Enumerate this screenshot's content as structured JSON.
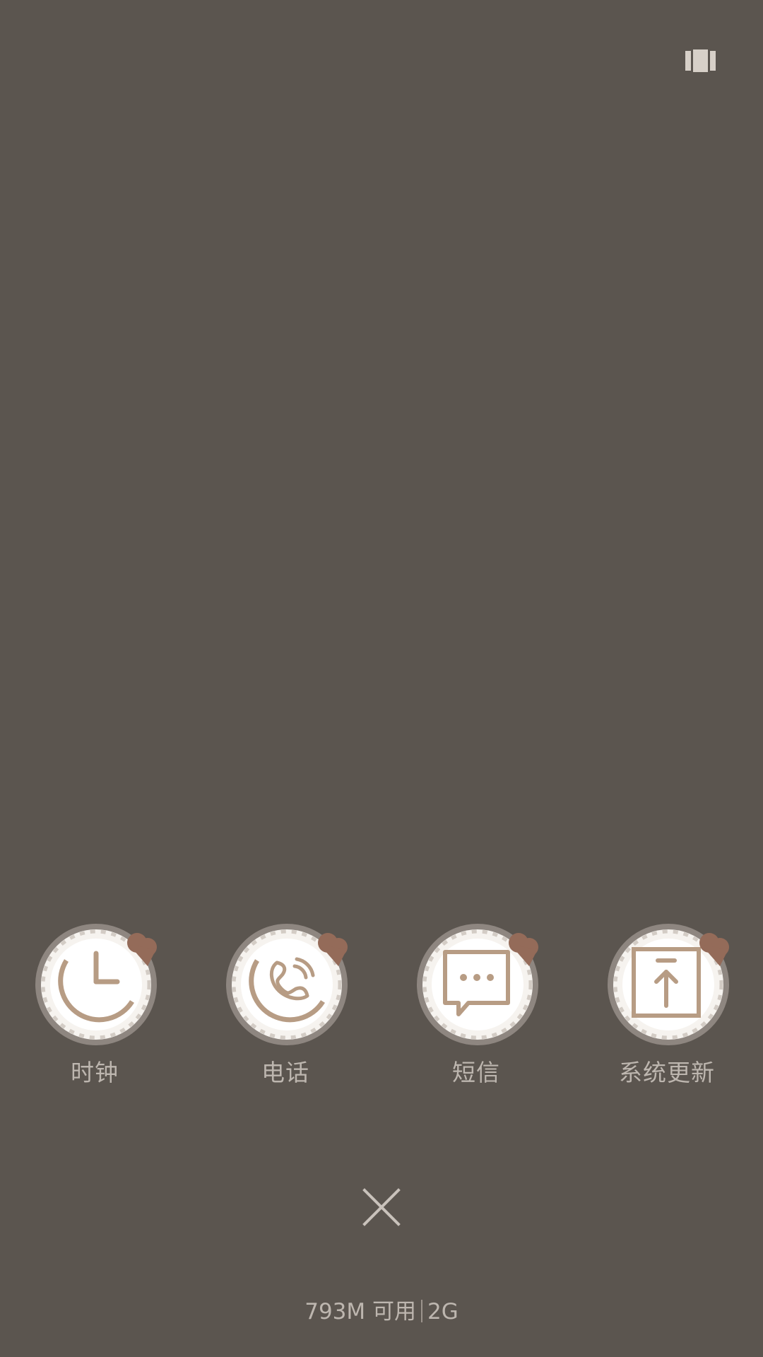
{
  "top_bar": {
    "view_toggle_icon": "multi-window-icon"
  },
  "recent_apps": [
    {
      "label": "时钟",
      "icon": "clock-icon"
    },
    {
      "label": "电话",
      "icon": "phone-icon"
    },
    {
      "label": "短信",
      "icon": "message-icon"
    },
    {
      "label": "系统更新",
      "icon": "system-update-icon"
    }
  ],
  "actions": {
    "close_icon": "close-icon"
  },
  "memory": {
    "available": "793M 可用",
    "total": "2G"
  },
  "colors": {
    "background": "#5b554f",
    "icon_stroke": "#b79c84",
    "label_text": "#bdb6af",
    "heart": "#946b59"
  }
}
